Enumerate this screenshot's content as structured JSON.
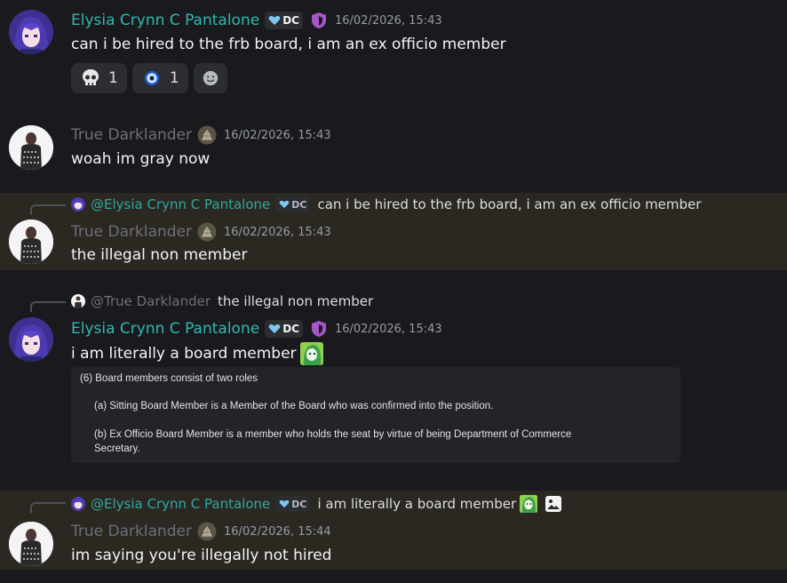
{
  "messages": [
    {
      "author": "Elysia Crynn C Pantalone",
      "tag": "DC",
      "timestamp": "16/02/2026, 15:43",
      "text": "can i be hired to the frb board, i am an ex officio member",
      "reactions": [
        {
          "icon": "skull-emoji",
          "count": "1"
        },
        {
          "icon": "eye-emoji",
          "count": "1"
        }
      ]
    },
    {
      "author": "True Darklander",
      "timestamp": "16/02/2026, 15:43",
      "text": "woah im gray now"
    },
    {
      "reply": {
        "author": "@Elysia Crynn C Pantalone",
        "tag": "DC",
        "text": "can i be hired to the frb board, i am an ex officio member"
      },
      "author": "True Darklander",
      "timestamp": "16/02/2026, 15:43",
      "text": "the illegal non member"
    },
    {
      "reply": {
        "author": "@True Darklander",
        "text": "the illegal non member"
      },
      "author": "Elysia Crynn C Pantalone",
      "tag": "DC",
      "timestamp": "16/02/2026, 15:43",
      "text": "i am literally a board member",
      "image_text": {
        "line1": "(6) Board members consist of two roles",
        "line2": "(a) Sitting Board Member is a Member of the Board who was confirmed into the position.",
        "line3": "(b) Ex Officio Board Member is a member who holds the seat by virtue of being Department of Commerce",
        "line4": "Secretary."
      }
    },
    {
      "reply": {
        "author": "@Elysia Crynn C Pantalone",
        "tag": "DC",
        "text": "i am literally a board member"
      },
      "author": "True Darklander",
      "timestamp": "16/02/2026, 15:44",
      "text": "im saying you're illegally not hired"
    }
  ],
  "colors": {
    "background": "#1a1a1e",
    "highlight": "#2b2822",
    "teal_name": "#2fb8b0",
    "gray_name": "#6d6f78",
    "shield": "#a855c7"
  }
}
